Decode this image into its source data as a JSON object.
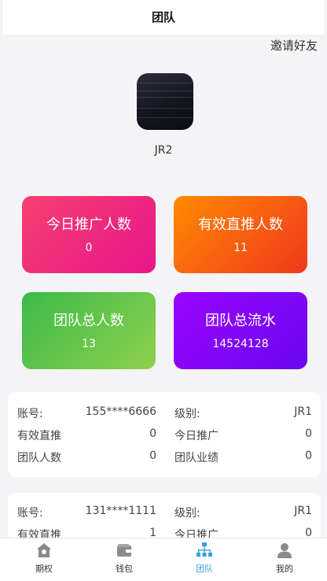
{
  "header": {
    "title": "团队",
    "invite_label": "邀请好友"
  },
  "profile": {
    "username": "JR2"
  },
  "stats": [
    {
      "label": "今日推广人数",
      "value": "0"
    },
    {
      "label": "有效直推人数",
      "value": "11"
    },
    {
      "label": "团队总人数",
      "value": "13"
    },
    {
      "label": "团队总流水",
      "value": "14524128"
    }
  ],
  "members": [
    {
      "account_label": "账号:",
      "account": "155****6666",
      "level_label": "级别:",
      "level": "JR1",
      "direct_label": "有效直推",
      "direct": "0",
      "today_label": "今日推广",
      "today": "0",
      "team_label": "团队人数",
      "team": "0",
      "perf_label": "团队业绩",
      "perf": "0"
    },
    {
      "account_label": "账号:",
      "account": "131****1111",
      "level_label": "级别:",
      "level": "JR1",
      "direct_label": "有效直推",
      "direct": "1",
      "today_label": "今日推广",
      "today": "0"
    }
  ],
  "tabbar": {
    "items": [
      {
        "label": "期权",
        "icon": "home-icon"
      },
      {
        "label": "钱包",
        "icon": "wallet-icon"
      },
      {
        "label": "团队",
        "icon": "team-icon"
      },
      {
        "label": "我的",
        "icon": "user-icon"
      }
    ],
    "active_color": "#3aa0de"
  }
}
